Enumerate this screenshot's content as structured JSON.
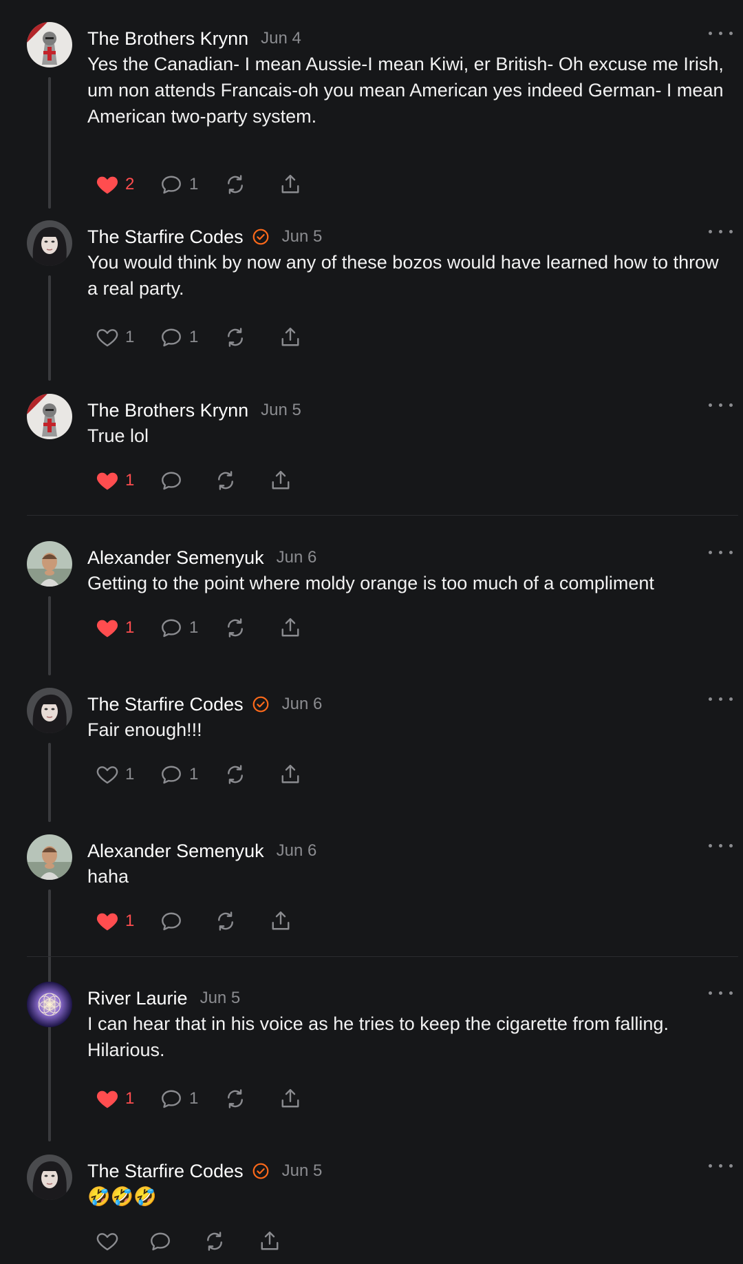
{
  "colors": {
    "background": "#161719",
    "text": "#ffffff",
    "muted": "#8b8c90",
    "like_red": "#ff4d4f",
    "verified_orange": "#ff6a1a"
  },
  "comments": [
    {
      "author": "The Brothers Krynn",
      "verified": false,
      "date": "Jun 4",
      "text": "Yes the Canadian- I mean Aussie-I mean Kiwi, er British- Oh excuse me Irish, um non attends Francais-oh you mean American yes indeed German- I mean American two-party system.",
      "liked": true,
      "likes": "2",
      "replies": "1",
      "avatar_icon": "knight-avatar"
    },
    {
      "author": "The Starfire Codes",
      "verified": true,
      "date": "Jun 5",
      "text": "You would think by now any of these bozos would have learned how to throw a real party.",
      "liked": false,
      "likes": "1",
      "replies": "1",
      "avatar_icon": "woman-portrait-avatar"
    },
    {
      "author": "The Brothers Krynn",
      "verified": false,
      "date": "Jun 5",
      "text": "True lol",
      "liked": true,
      "likes": "1",
      "replies": "",
      "avatar_icon": "knight-avatar"
    },
    {
      "author": "Alexander Semenyuk",
      "verified": false,
      "date": "Jun 6",
      "text": "Getting to the point where moldy orange is too much of a compliment",
      "liked": true,
      "likes": "1",
      "replies": "1",
      "avatar_icon": "man-portrait-avatar"
    },
    {
      "author": "The Starfire Codes",
      "verified": true,
      "date": "Jun 6",
      "text": "Fair enough!!!",
      "liked": false,
      "likes": "1",
      "replies": "1",
      "avatar_icon": "woman-portrait-avatar"
    },
    {
      "author": "Alexander Semenyuk",
      "verified": false,
      "date": "Jun 6",
      "text": "haha",
      "liked": true,
      "likes": "1",
      "replies": "",
      "avatar_icon": "man-portrait-avatar"
    },
    {
      "author": "River Laurie",
      "verified": false,
      "date": "Jun 5",
      "text": "I can hear that in his voice as he tries to keep the cigarette from falling. Hilarious.",
      "liked": true,
      "likes": "1",
      "replies": "1",
      "avatar_icon": "flower-of-life-avatar"
    },
    {
      "author": "The Starfire Codes",
      "verified": true,
      "date": "Jun 5",
      "text": "🤣🤣🤣",
      "liked": false,
      "likes": "",
      "replies": "",
      "avatar_icon": "woman-portrait-avatar"
    }
  ]
}
